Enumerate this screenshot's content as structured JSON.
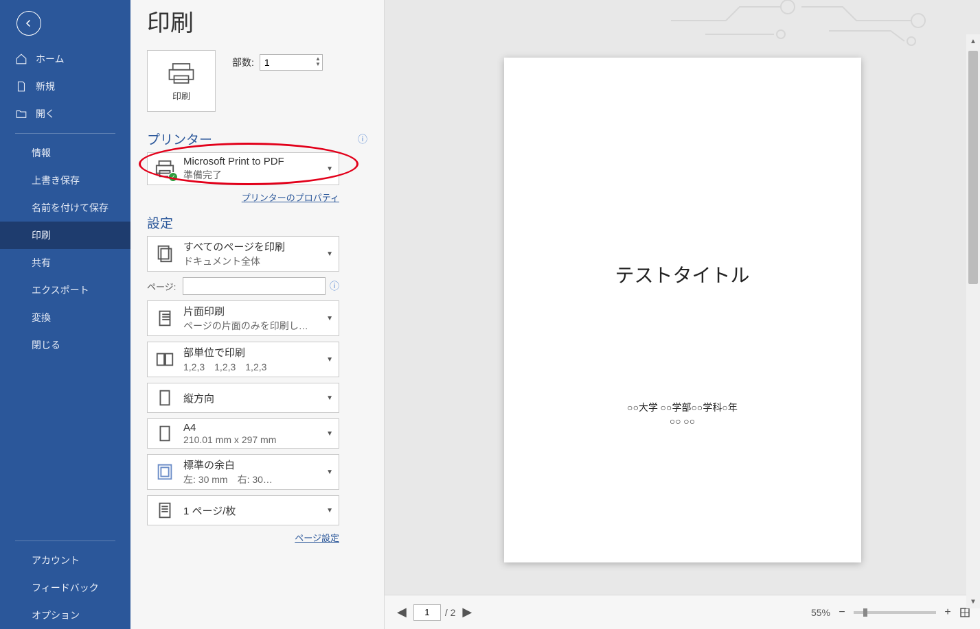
{
  "sidebar": {
    "home": "ホーム",
    "new": "新規",
    "open": "開く",
    "info": "情報",
    "save": "上書き保存",
    "save_as": "名前を付けて保存",
    "print": "印刷",
    "share": "共有",
    "export": "エクスポート",
    "convert": "変換",
    "close": "閉じる",
    "account": "アカウント",
    "feedback": "フィードバック",
    "options": "オプション"
  },
  "page": {
    "title": "印刷",
    "print_button": "印刷",
    "copies_label": "部数:",
    "copies_value": "1"
  },
  "printer": {
    "section_label": "プリンター",
    "name": "Microsoft Print to PDF",
    "status": "準備完了",
    "properties_link": "プリンターのプロパティ"
  },
  "settings": {
    "section_label": "設定",
    "print_all_pages": {
      "line1": "すべてのページを印刷",
      "line2": "ドキュメント全体"
    },
    "pages_label": "ページ:",
    "one_side": {
      "line1": "片面印刷",
      "line2": "ページの片面のみを印刷し…"
    },
    "collate": {
      "line1": "部単位で印刷",
      "line2": "1,2,3　1,2,3　1,2,3"
    },
    "orientation": {
      "line1": "縦方向"
    },
    "paper": {
      "line1": "A4",
      "line2": "210.01 mm x 297 mm"
    },
    "margins": {
      "line1": "標準の余白",
      "line2": "左: 30 mm　右: 30…"
    },
    "pages_per_sheet": {
      "line1": "1 ページ/枚"
    },
    "page_setup_link": "ページ設定"
  },
  "preview": {
    "doc_title": "テストタイトル",
    "doc_line1": "○○大学 ○○学部○○学科○年",
    "doc_line2": "○○ ○○",
    "current_page": "1",
    "total_pages": "/ 2",
    "zoom_pct": "55%"
  }
}
